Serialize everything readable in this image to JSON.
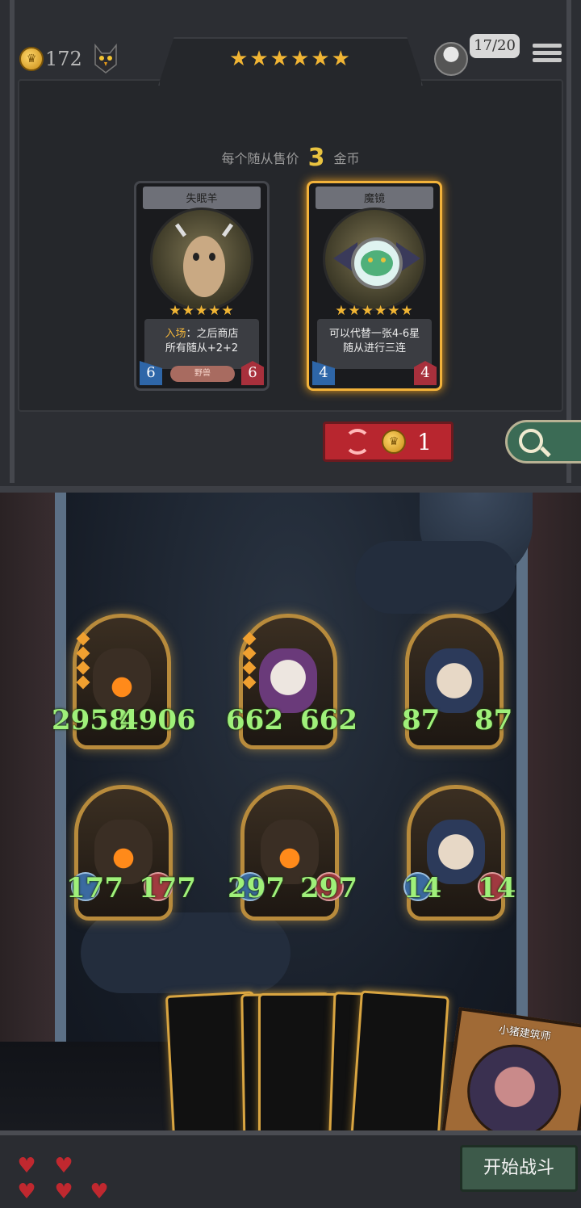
{
  "hud": {
    "gold": "172",
    "tier_stars": "★★★★★★",
    "board_count": "17/20"
  },
  "shop": {
    "sell_prefix": "每个随从售价",
    "sell_price": "3",
    "sell_suffix": "金币",
    "cards": [
      {
        "name": "失眠羊",
        "stars": "★★★★★",
        "desc_highlight": "入场",
        "desc_line1": "：之后商店",
        "desc_line2": "所有随从+2+2",
        "attack": "6",
        "health": "6",
        "tribe": "野兽"
      },
      {
        "name": "魔镜",
        "stars": "★★★★★★",
        "desc_line1": "可以代替一张4-6星",
        "desc_line2": "随从进行三连",
        "attack": "4",
        "health": "4"
      }
    ],
    "refresh_cost": "1"
  },
  "board": {
    "minions": [
      {
        "type": "tree",
        "attack": "2958",
        "health": "4906"
      },
      {
        "type": "goat",
        "attack": "662",
        "health": "662"
      },
      {
        "type": "rabbit",
        "attack": "87",
        "health": "87"
      },
      {
        "type": "tree",
        "attack": "177",
        "health": "177"
      },
      {
        "type": "tree",
        "attack": "297",
        "health": "297"
      },
      {
        "type": "rabbit",
        "attack": "14",
        "health": "14"
      }
    ]
  },
  "featured_card": {
    "name": "小猪建筑师"
  },
  "start_button": "开始战斗",
  "lives": 5,
  "colors": {
    "gold": "#f1b534",
    "stat_green": "#9ff07a",
    "refresh_red": "#b8262f",
    "start_green": "#3d5a4a"
  }
}
